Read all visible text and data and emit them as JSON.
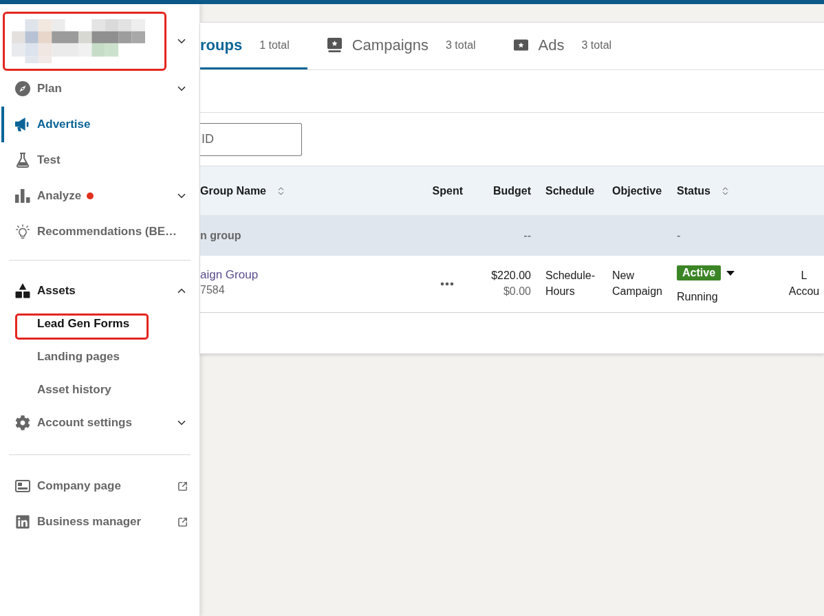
{
  "sidebar": {
    "account": {
      "highlighted": true,
      "expanded": false
    },
    "sections": [
      {
        "items": [
          {
            "kind": "group",
            "label": "Plan",
            "selected": false,
            "alert": false,
            "expanded": false
          },
          {
            "kind": "page",
            "label": "Advertise",
            "selected": true,
            "alert": false
          },
          {
            "kind": "page",
            "label": "Test",
            "selected": false,
            "alert": false
          },
          {
            "kind": "group",
            "label": "Analyze",
            "selected": false,
            "alert": true,
            "expanded": false
          },
          {
            "kind": "page",
            "label": "Recommendations (BE…",
            "selected": false,
            "alert": false
          }
        ]
      },
      {
        "items": [
          {
            "kind": "group",
            "label": "Assets",
            "selected": false,
            "alert": false,
            "expanded": true,
            "children": [
              {
                "label": "Lead Gen Forms",
                "selected": true,
                "highlighted": true
              },
              {
                "label": "Landing pages",
                "selected": false,
                "highlighted": false
              },
              {
                "label": "Asset history",
                "selected": false,
                "highlighted": false
              }
            ]
          },
          {
            "kind": "group",
            "label": "Account settings",
            "selected": false,
            "alert": false,
            "expanded": false
          }
        ]
      },
      {
        "items": [
          {
            "kind": "external",
            "label": "Company page",
            "selected": false,
            "alert": false
          },
          {
            "kind": "external",
            "label": "Business manager",
            "selected": false,
            "alert": false
          }
        ]
      }
    ]
  },
  "main": {
    "tabs": [
      {
        "label": "roups",
        "count": "1 total",
        "selected": true
      },
      {
        "label": "Campaigns",
        "count": "3 total",
        "selected": false
      },
      {
        "label": "Ads",
        "count": "3 total",
        "selected": false
      }
    ],
    "search": {
      "placeholder": "ID"
    },
    "table": {
      "columns": [
        {
          "label": "Group Name",
          "sortable": true
        },
        {
          "label": "Spent",
          "sortable": false
        },
        {
          "label": "Budget",
          "sortable": false
        },
        {
          "label": "Schedule",
          "sortable": false
        },
        {
          "label": "Objective",
          "sortable": false
        },
        {
          "label": "Status",
          "sortable": true
        }
      ],
      "summary_row": {
        "name": "n group",
        "budget": "--",
        "status": "-"
      },
      "rows": [
        {
          "name": "aign Group",
          "id": "7584",
          "budget": "$220.00",
          "budget_secondary": "$0.00",
          "schedule": "Schedule-Hours",
          "objective": "New Campaign",
          "status": "Active",
          "delivery": "Running",
          "column_7": "L",
          "column_7_secondary": "Accou"
        }
      ]
    }
  }
}
